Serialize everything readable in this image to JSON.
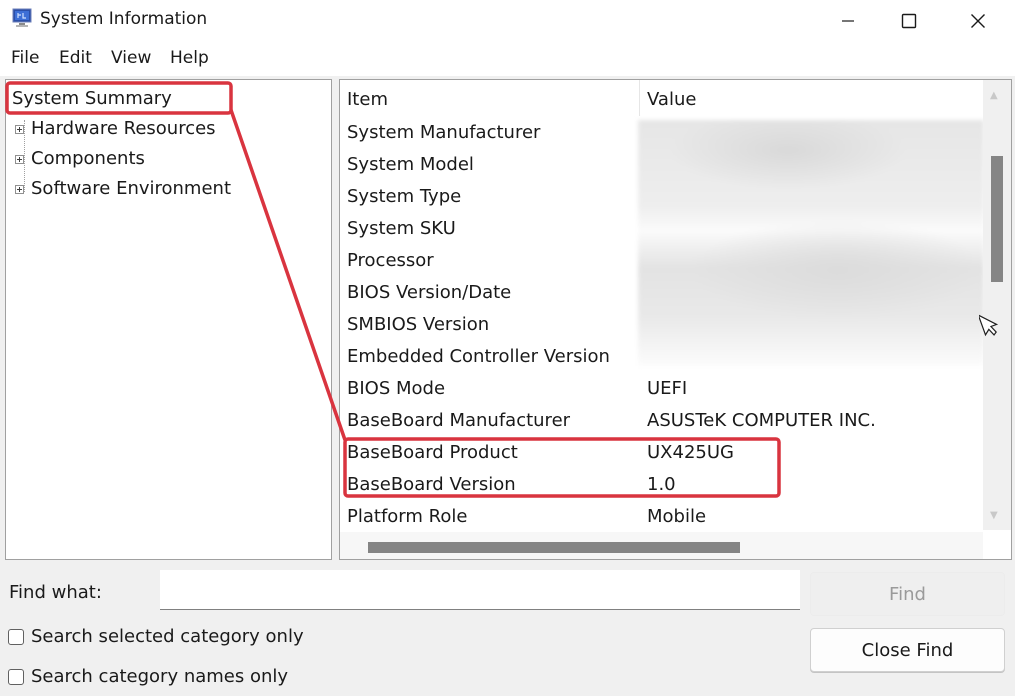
{
  "window": {
    "title": "System Information",
    "icon": "system-information-icon",
    "controls": [
      "minimize-icon",
      "maximize-icon",
      "close-icon"
    ]
  },
  "menu": {
    "items": [
      {
        "label": "File"
      },
      {
        "label": "Edit"
      },
      {
        "label": "View"
      },
      {
        "label": "Help"
      }
    ]
  },
  "tree": {
    "items": [
      {
        "label": "System Summary",
        "selected": true,
        "expandable": false
      },
      {
        "label": "Hardware Resources",
        "expandable": true
      },
      {
        "label": "Components",
        "expandable": true
      },
      {
        "label": "Software Environment",
        "expandable": true
      }
    ]
  },
  "details": {
    "columns": [
      "Item",
      "Value"
    ],
    "rows": [
      {
        "item": "System Manufacturer",
        "value": "",
        "redacted": true
      },
      {
        "item": "System Model",
        "value": "",
        "redacted": true
      },
      {
        "item": "System Type",
        "value": "",
        "redacted": true
      },
      {
        "item": "System SKU",
        "value": "",
        "redacted": true
      },
      {
        "item": "Processor",
        "value": "",
        "redacted": true
      },
      {
        "item": "BIOS Version/Date",
        "value": "",
        "redacted": true
      },
      {
        "item": "SMBIOS Version",
        "value": "",
        "redacted": true
      },
      {
        "item": "Embedded Controller Version",
        "value": "",
        "redacted": true
      },
      {
        "item": "BIOS Mode",
        "value": "UEFI"
      },
      {
        "item": "BaseBoard Manufacturer",
        "value": "ASUSTeK COMPUTER INC."
      },
      {
        "item": "BaseBoard Product",
        "value": "UX425UG",
        "highlighted": true
      },
      {
        "item": "BaseBoard Version",
        "value": "1.0",
        "highlighted": true
      },
      {
        "item": "Platform Role",
        "value": "Mobile"
      }
    ]
  },
  "find": {
    "label": "Find what:",
    "value": "",
    "placeholder": "",
    "find_button": "Find",
    "close_button": "Close Find",
    "checkboxes": [
      {
        "label": "Search selected category only",
        "checked": false
      },
      {
        "label": "Search category names only",
        "checked": false
      }
    ]
  },
  "annotation": {
    "color": "#d9343f"
  }
}
